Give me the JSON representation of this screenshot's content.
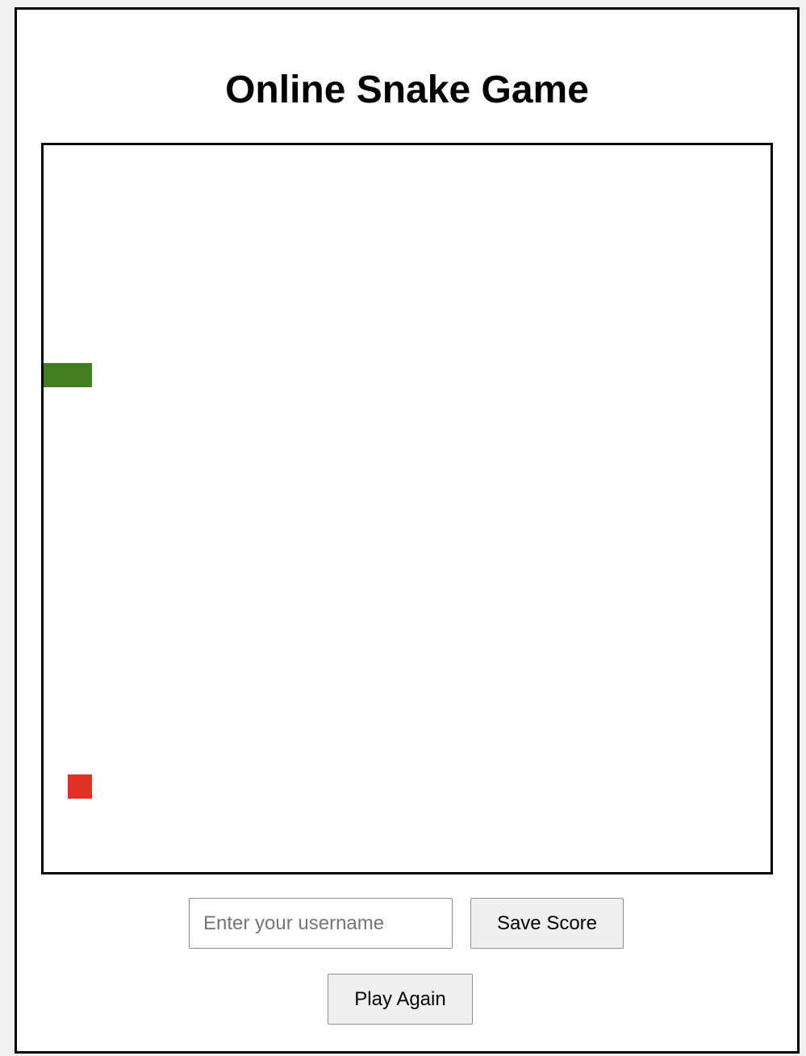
{
  "title": "Online Snake Game",
  "game": {
    "snake_color": "#417f22",
    "food_color": "#e03223",
    "board_border_color": "#000000"
  },
  "form": {
    "username_placeholder": "Enter your username",
    "username_value": "",
    "save_label": "Save Score"
  },
  "controls": {
    "play_again_label": "Play Again"
  }
}
